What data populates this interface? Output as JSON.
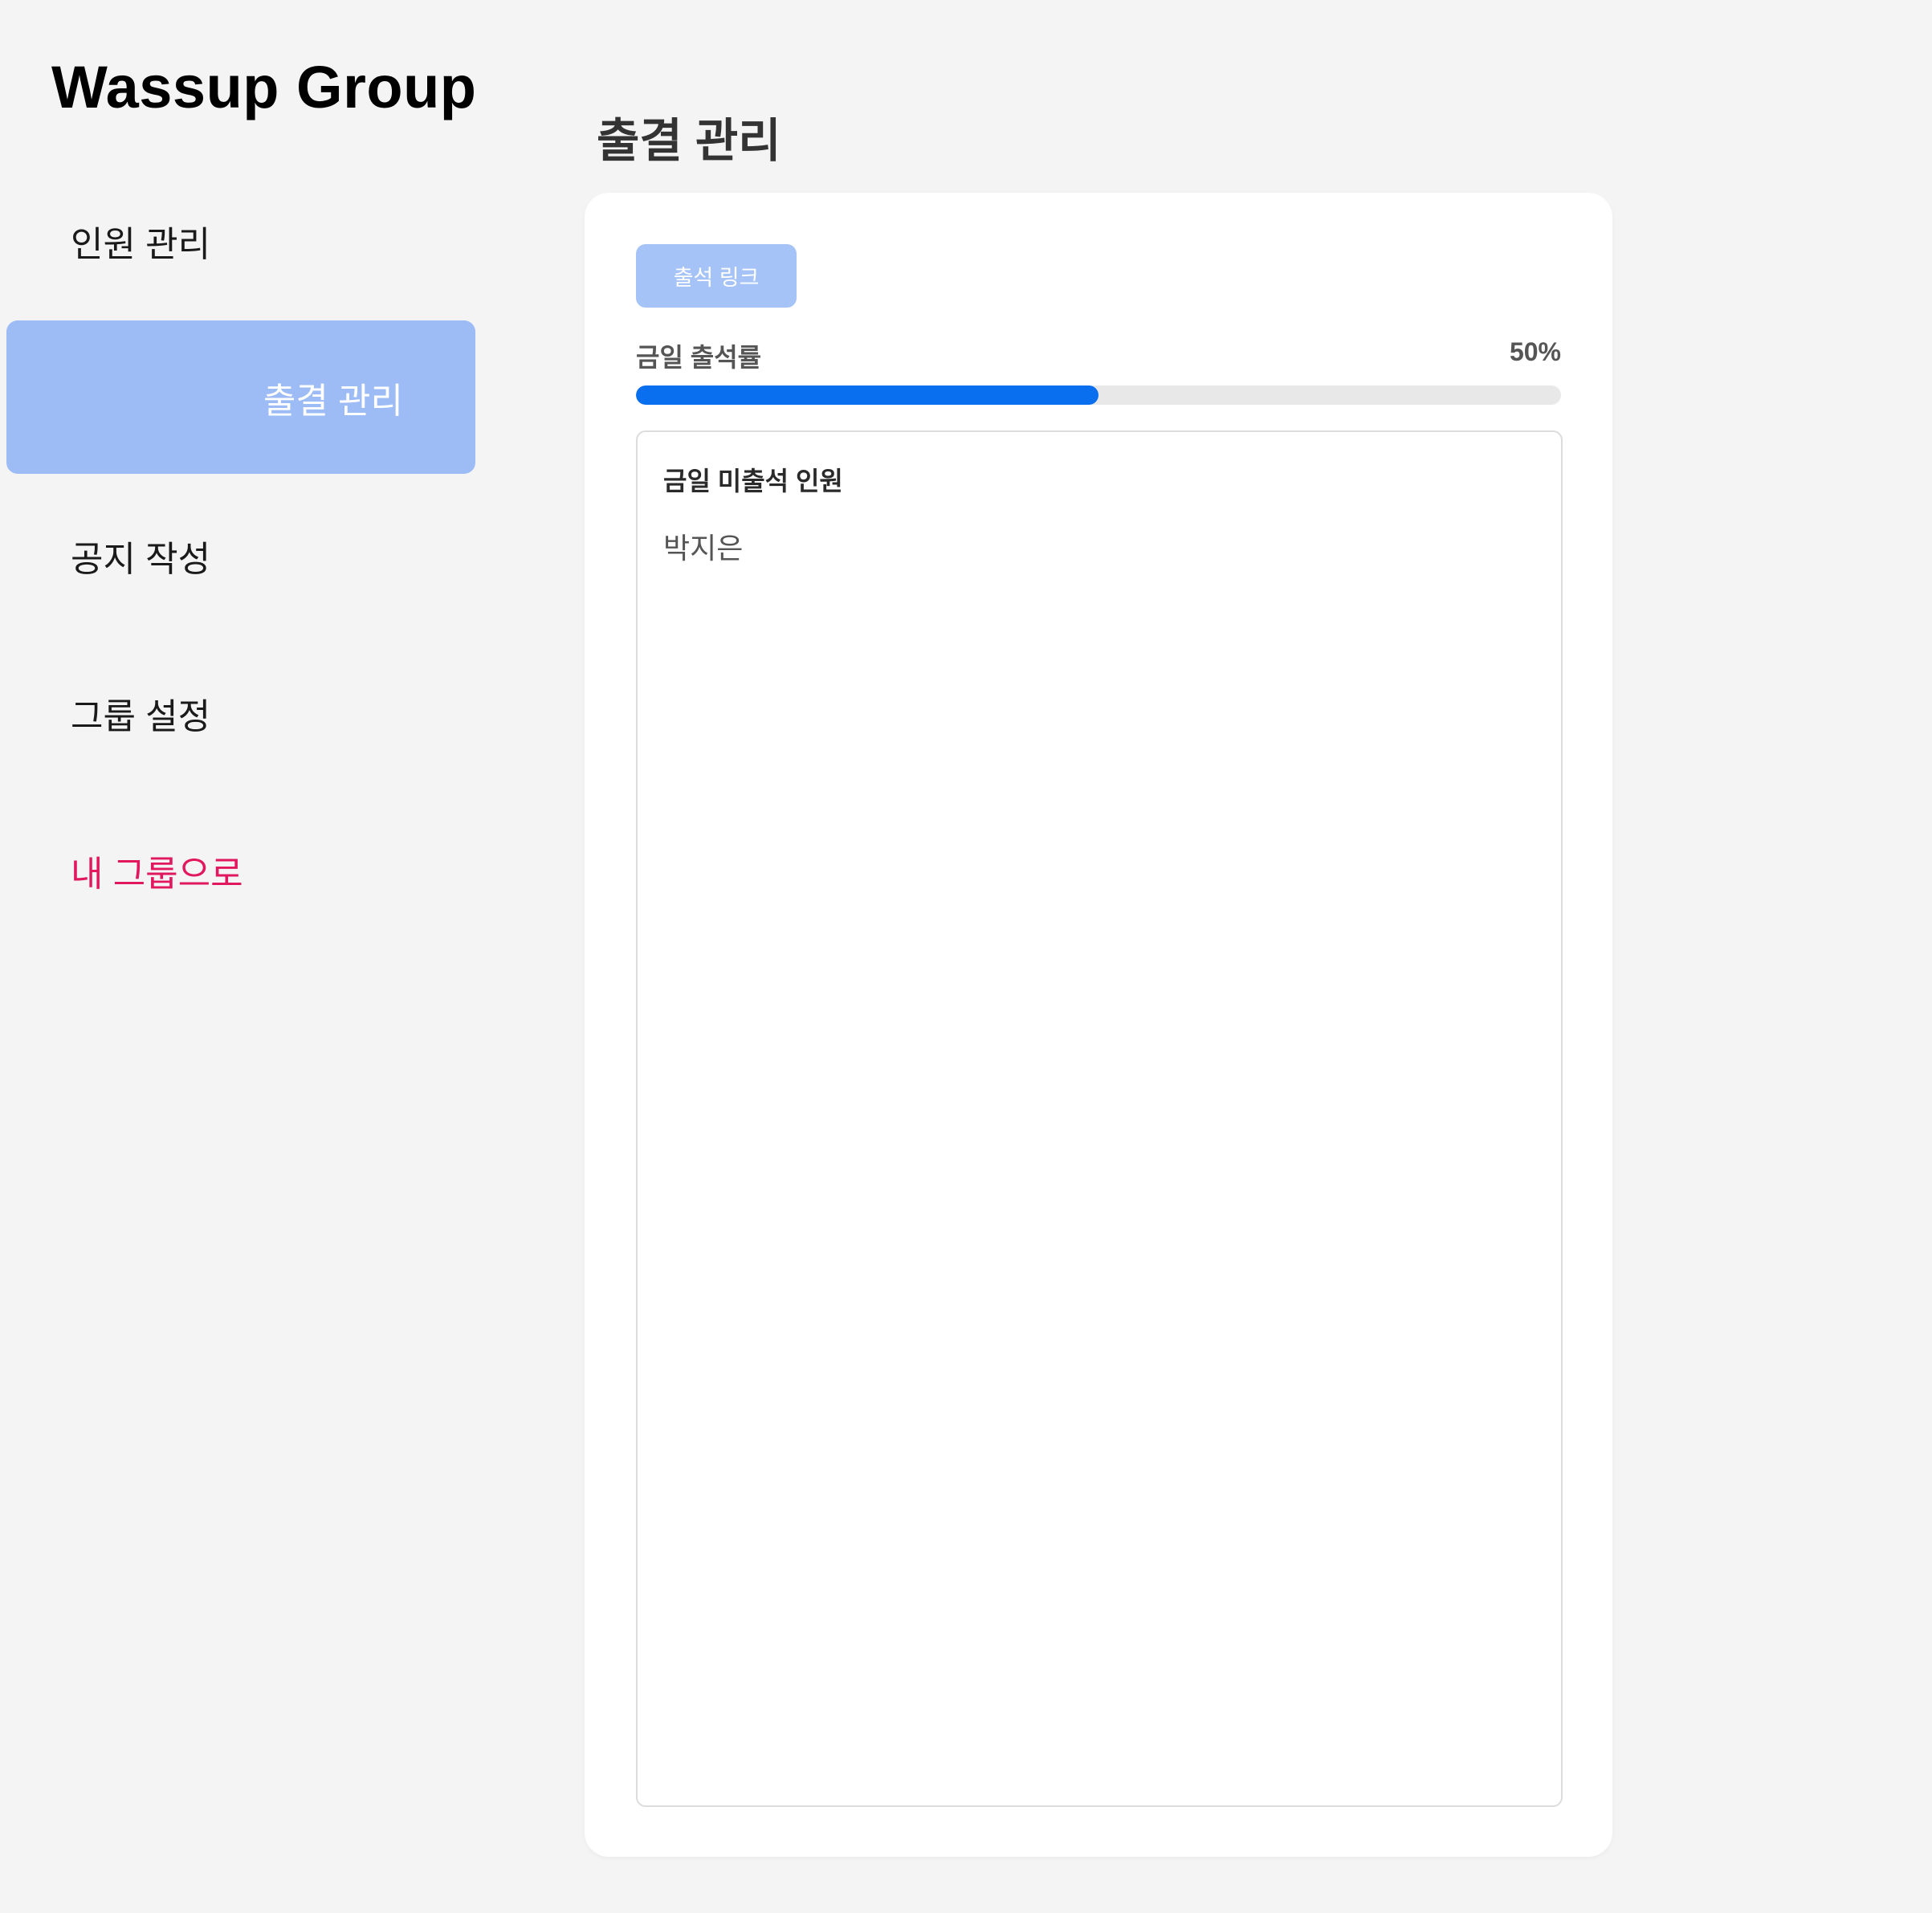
{
  "brand": "Wassup Group",
  "sidebar": {
    "items": [
      {
        "label": "인원 관리"
      },
      {
        "label": "출결 관리"
      },
      {
        "label": "공지 작성"
      },
      {
        "label": "그룹 설정"
      },
      {
        "label": "내 그룹으로"
      }
    ]
  },
  "main": {
    "title": "출결 관리",
    "attendance_link_label": "출석 링크",
    "rate": {
      "label": "금일 출석률",
      "value_text": "50%",
      "value": 0.5
    },
    "absent": {
      "title": "금일 미출석 인원",
      "members": [
        "박지은"
      ]
    }
  },
  "colors": {
    "page_background": "#f4f4f5",
    "active_nav": "#9dbcf5",
    "link_button": "#a5c3f7",
    "progress_fill": "#0a6fee",
    "progress_track": "#e8e8e8",
    "home_link": "#e1185e"
  }
}
